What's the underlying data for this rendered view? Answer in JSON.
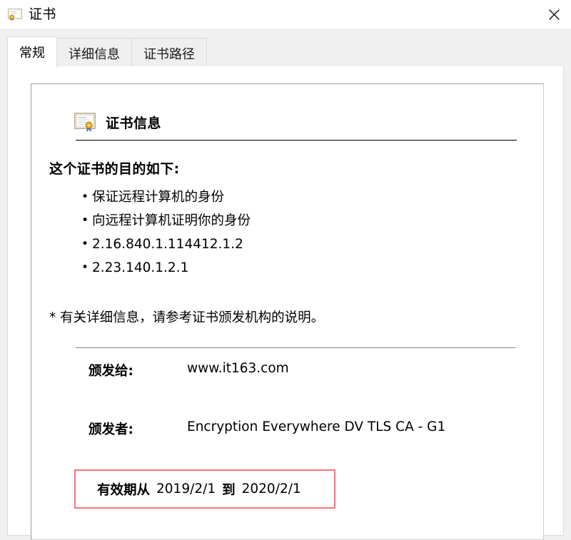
{
  "window": {
    "title": "证书",
    "title_icon": "certificate-icon",
    "close_label": "✕"
  },
  "tabs": [
    {
      "label": "常规",
      "active": true
    },
    {
      "label": "详细信息",
      "active": false
    },
    {
      "label": "证书路径",
      "active": false
    }
  ],
  "general": {
    "header": {
      "icon": "certificate-icon",
      "title": "证书信息"
    },
    "purpose_heading": "这个证书的目的如下:",
    "bullet": "•",
    "purposes": [
      "保证远程计算机的身份",
      "向远程计算机证明你的身份",
      "2.16.840.1.114412.1.2",
      "2.23.140.1.2.1"
    ],
    "footnote": "* 有关详细信息，请参考证书颁发机构的说明。",
    "issued_to": {
      "label": "颁发给:",
      "value": "www.it163.com"
    },
    "issued_by": {
      "label": "颁发者:",
      "value": "Encryption Everywhere DV TLS CA - G1"
    },
    "validity": {
      "from_label": "有效期从",
      "valid_from": "2019/2/1",
      "to_label": "到",
      "valid_to": "2020/2/1",
      "highlight_color": "#f4777f"
    }
  }
}
